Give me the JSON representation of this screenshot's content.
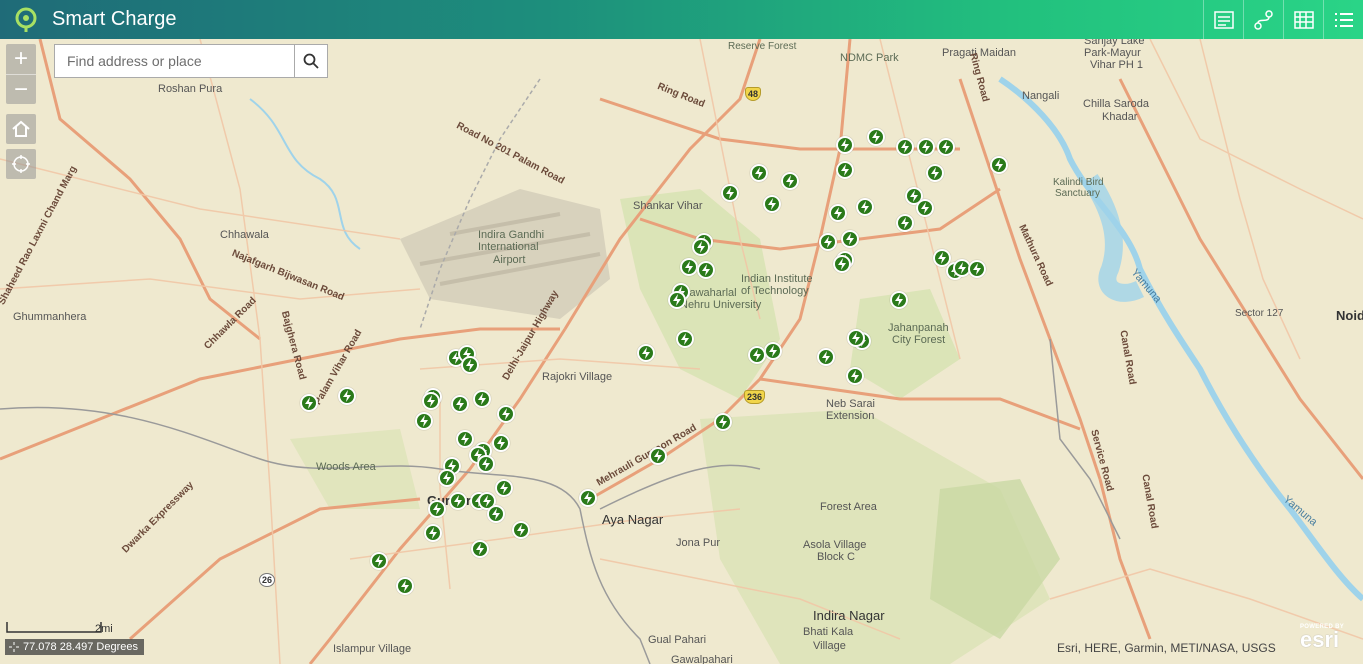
{
  "app": {
    "title": "Smart Charge"
  },
  "header_tools": [
    {
      "name": "legend-icon"
    },
    {
      "name": "directions-icon"
    },
    {
      "name": "table-icon"
    },
    {
      "name": "layer-list-icon"
    }
  ],
  "search": {
    "placeholder": "Find address or place"
  },
  "map": {
    "place_labels": [
      "Roshan Pura",
      "Chhawala",
      "Ghummanhera",
      "Shankar Vihar",
      "Indira Gandhi",
      "International",
      "Airport",
      "Rajokri Village",
      "Woods Area",
      "Gurugram",
      "Aya Nagar",
      "Jona Pur",
      "Asola Village",
      "Block C",
      "Forest Area",
      "Indira Nagar",
      "Bhati Kala",
      "Village",
      "Gual Pahari",
      "Gawalpahari",
      "Islampur Village",
      "Neb Sarai",
      "Extension",
      "Jahanpanah",
      "City Forest",
      "Indian Institute",
      "of Technology",
      "Jawaharlal",
      "Nehru University",
      "NDMC Park",
      "Pragati Maidan",
      "Sanjay Lake",
      "Park-Mayur",
      "Vihar PH 1",
      "Nangali",
      "Chilla Saroda",
      "Khadar",
      "Kalindi Bird",
      "Sanctuary",
      "Reserve Forest",
      "Sector 127",
      "Noida"
    ],
    "road_labels": [
      "Ring Road",
      "Road No 201 Palam Road",
      "Najafgarh Bijwasan Road",
      "Bajghera Road",
      "Palam Vihar Road",
      "Delhi-Jaipur Highway",
      "Mehrauli Gurgaon Road",
      "Dwarka Expressway",
      "Mathura Road",
      "Canal Road",
      "Service Road",
      "Shaheed Rao Laxmi Chand Marg",
      "Chhawla Road",
      "Yamuna"
    ],
    "highway_shields": [
      "48",
      "236",
      "26"
    ],
    "station_icon": "charging-station-icon",
    "station_color": "#2a7a1a",
    "station_count": 72
  },
  "coordinates": {
    "text": "77.078 28.497 Degrees"
  },
  "scale": {
    "label": "2mi"
  },
  "attribution": {
    "text": "Esri, HERE, Garmin, METI/NASA, USGS"
  },
  "esri_logo": {
    "powered_by": "POWERED BY",
    "brand": "esri"
  },
  "colors": {
    "header_start": "#1f6b78",
    "header_end": "#2ad487",
    "land": "#efe9cf",
    "water": "#9fd3ea",
    "road_major": "#e8a07a",
    "green": "#c7d9a7"
  }
}
